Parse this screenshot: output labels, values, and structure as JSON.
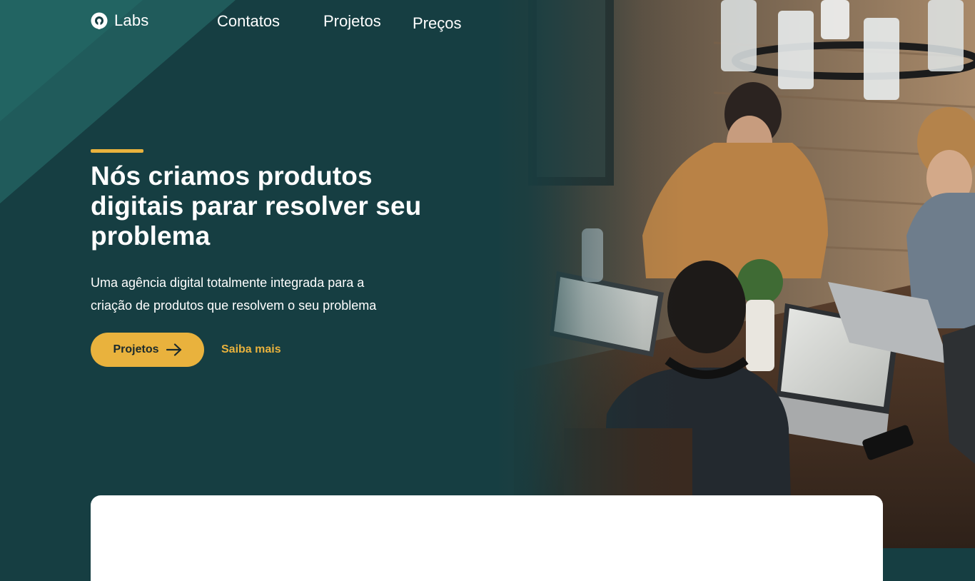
{
  "brand": {
    "name": "Labs",
    "logo_icon": "circle-o-logo-icon"
  },
  "nav": {
    "items": [
      {
        "label": "Contatos"
      },
      {
        "label": "Projetos"
      },
      {
        "label": "Preços"
      }
    ]
  },
  "hero": {
    "title": "Nós criamos produtos digitais parar resolver seu problema",
    "description": "Uma agência digital totalmente integrada para a criação de produtos que resolvem o seu problema",
    "primary_button": {
      "label": "Projetos",
      "icon": "arrow-right-icon"
    },
    "secondary_link": {
      "label": "Saiba mais"
    },
    "image_alt": "team-working-on-laptops-photo"
  },
  "colors": {
    "background": "#163e42",
    "accent": "#e9b23d",
    "diagonal": "#22605f",
    "card": "#ffffff"
  }
}
